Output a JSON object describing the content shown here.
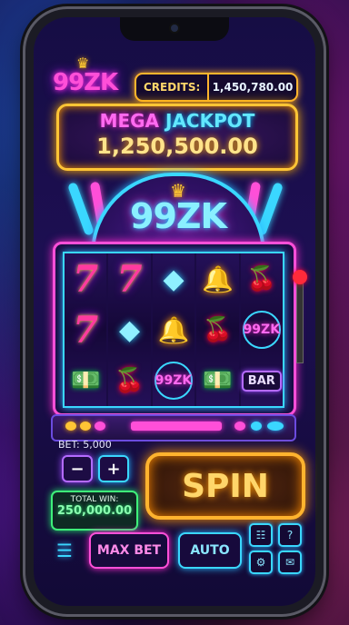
{
  "brand": {
    "logo": "99ZK",
    "crown": "♛"
  },
  "credits": {
    "label": "CREDITS:",
    "value": "1,450,780.00"
  },
  "jackpot": {
    "title_a": "MEGA",
    "title_b": "JACKPOT",
    "value": "1,250,500.00"
  },
  "marquee": {
    "text": "99ZK",
    "crown": "♛"
  },
  "reels": [
    [
      "7",
      "7",
      "cash"
    ],
    [
      "7",
      "diamond",
      "cherry"
    ],
    [
      "diamond",
      "bell",
      "99ZK"
    ],
    [
      "bell",
      "cherry",
      "cash"
    ],
    [
      "cherry",
      "99ZK",
      "BAR"
    ]
  ],
  "symbols": {
    "7": "7",
    "diamond": "◆",
    "bell": "🔔",
    "cherry": "🍒",
    "cash": "💵",
    "99ZK": "99ZK",
    "BAR": "BAR"
  },
  "bet": {
    "label": "BET: 5,000",
    "minus": "−",
    "plus": "+"
  },
  "spin": {
    "label": "SPIN"
  },
  "total_win": {
    "label": "TOTAL WIN:",
    "value": "250,000.00"
  },
  "bottom": {
    "menu_icon": "☰",
    "max_bet": "MAX BET",
    "auto": "AUTO",
    "paytable_icon": "☷",
    "help_icon": "?",
    "settings_icon": "⚙",
    "chat_icon": "✉"
  },
  "colors": {
    "accent_pink": "#ff4fd8",
    "accent_cyan": "#3ad7ff",
    "gold": "#ffb32e",
    "green": "#3ef07a"
  }
}
